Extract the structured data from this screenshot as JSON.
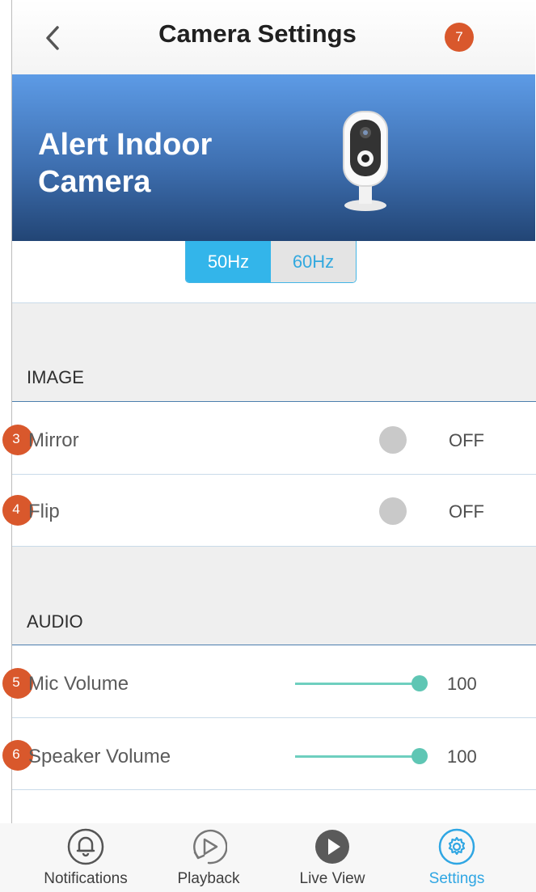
{
  "header": {
    "title": "Camera Settings",
    "badge": "7"
  },
  "banner": {
    "title": "Alert Indoor Camera"
  },
  "frequency": {
    "options": [
      "50Hz",
      "60Hz"
    ],
    "selected": "50Hz"
  },
  "sections": {
    "image": {
      "label": "IMAGE",
      "rows": [
        {
          "badge": "3",
          "label": "Mirror",
          "state": "OFF"
        },
        {
          "badge": "4",
          "label": "Flip",
          "state": "OFF"
        }
      ]
    },
    "audio": {
      "label": "AUDIO",
      "rows": [
        {
          "badge": "5",
          "label": "Mic Volume",
          "value": "100",
          "level": 1.0
        },
        {
          "badge": "6",
          "label": "Speaker Volume",
          "value": "100",
          "level": 1.0
        }
      ]
    }
  },
  "tabs": [
    {
      "label": "Notifications",
      "icon": "bell-icon"
    },
    {
      "label": "Playback",
      "icon": "playback-icon"
    },
    {
      "label": "Live View",
      "icon": "play-circle-icon"
    },
    {
      "label": "Settings",
      "icon": "gear-icon",
      "active": true
    }
  ],
  "colors": {
    "accent": "#2fa6e3",
    "badge": "#d9582c",
    "slider": "#5fc6b4",
    "banner": "#3e6fb0"
  }
}
